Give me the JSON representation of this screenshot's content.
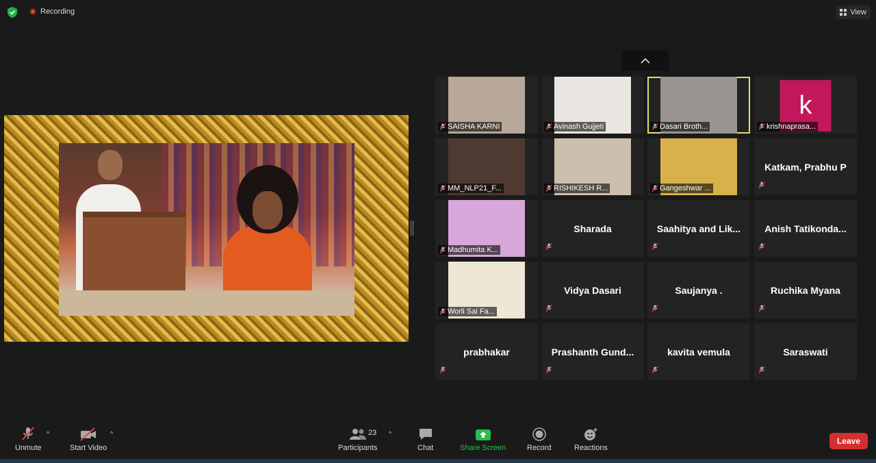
{
  "topbar": {
    "recording_label": "Recording",
    "view_label": "View"
  },
  "shared_screen": {
    "description_icon": "shared-photo"
  },
  "gallery": {
    "tiles": [
      {
        "name": "SAISHA KARNI",
        "video": true,
        "bg": "#b8a89a"
      },
      {
        "name": "Avinash Gujjeti",
        "video": true,
        "bg": "#e9e6e2"
      },
      {
        "name": "Dasari Broth...",
        "video": true,
        "bg": "#9a9590",
        "active": true
      },
      {
        "name": "krishnaprasa...",
        "avatar": "k"
      },
      {
        "name": "MM_NLP21_F...",
        "video": true,
        "bg": "#4e3a31"
      },
      {
        "name": "RISHIKESH R...",
        "video": true,
        "bg": "#cdbfad"
      },
      {
        "name": "Gangeshwar ...",
        "video": true,
        "bg": "#d8b14a"
      },
      {
        "name": "Katkam, Prabhu P",
        "video": false
      },
      {
        "name": "Madhumita K...",
        "video": true,
        "bg": "#d7a7d9"
      },
      {
        "name": "Sharada",
        "video": false
      },
      {
        "name": "Saahitya and Lik...",
        "video": false
      },
      {
        "name": "Anish Tatikonda...",
        "video": false
      },
      {
        "name": "Worli Sai Fa...",
        "video": true,
        "bg": "#f0e6d6"
      },
      {
        "name": "Vidya Dasari",
        "video": false
      },
      {
        "name": "Saujanya .",
        "video": false
      },
      {
        "name": "Ruchika Myana",
        "video": false
      },
      {
        "name": "prabhakar",
        "video": false
      },
      {
        "name": "Prashanth Gund...",
        "video": false
      },
      {
        "name": "kavita vemula",
        "video": false
      },
      {
        "name": "Saraswati",
        "video": false
      }
    ]
  },
  "toolbar": {
    "unmute": "Unmute",
    "start_video": "Start Video",
    "participants": "Participants",
    "participant_count": "23",
    "chat": "Chat",
    "share_screen": "Share Screen",
    "record": "Record",
    "reactions": "Reactions",
    "leave": "Leave"
  },
  "colors": {
    "share_green": "#24c04a",
    "leave_red": "#d32f2f",
    "active_speaker": "#d9e56b"
  }
}
